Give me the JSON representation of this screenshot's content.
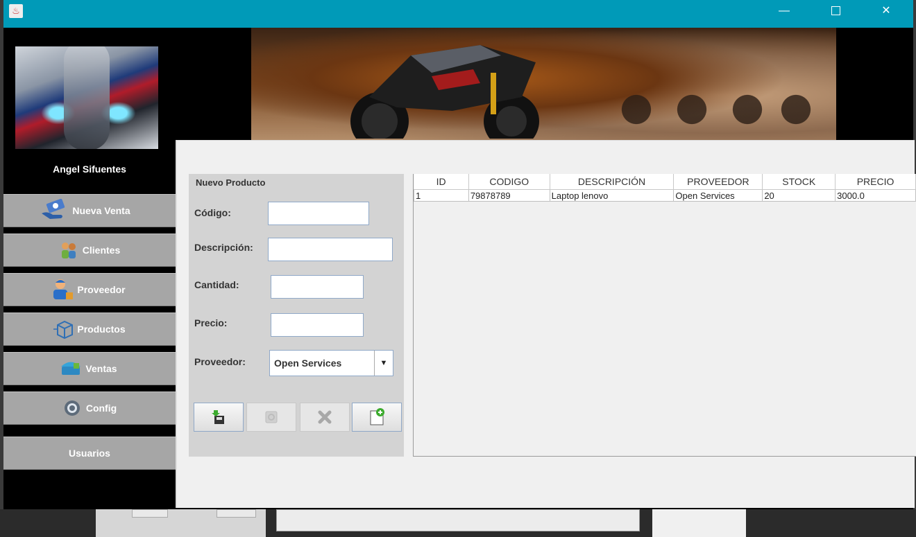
{
  "window": {
    "title": ""
  },
  "user": {
    "name": "Angel Sifuentes"
  },
  "nav": {
    "items": [
      {
        "label": "Nueva Venta",
        "icon": "hand-money-icon"
      },
      {
        "label": "Clientes",
        "icon": "people-icon"
      },
      {
        "label": "Proveedor",
        "icon": "supplier-worker-icon"
      },
      {
        "label": "Productos",
        "icon": "box-icon"
      },
      {
        "label": "Ventas",
        "icon": "basket-icon"
      },
      {
        "label": "Config",
        "icon": "gear-icon"
      },
      {
        "label": "Usuarios",
        "icon": ""
      }
    ]
  },
  "form": {
    "title": "Nuevo Producto",
    "codigo_label": "Código:",
    "codigo_value": "",
    "descripcion_label": "Descripción:",
    "descripcion_value": "",
    "cantidad_label": "Cantidad:",
    "cantidad_value": "",
    "precio_label": "Precio:",
    "precio_value": "",
    "proveedor_label": "Proveedor:",
    "proveedor_selected": "Open Services",
    "buttons": [
      "save-icon",
      "edit-icon",
      "delete-icon",
      "new-document-icon"
    ]
  },
  "table": {
    "columns": [
      "ID",
      "CODIGO",
      "DESCRIPCIÓN",
      "PROVEEDOR",
      "STOCK",
      "PRECIO"
    ],
    "rows": [
      [
        "1",
        "79878789",
        "Laptop lenovo",
        "Open Services",
        "20",
        "3000.0"
      ]
    ]
  },
  "colors": {
    "titlebar": "#009ab8",
    "sidebar": "#000000",
    "nav_button": "#a6a6a6",
    "content": "#f0f0f0"
  }
}
